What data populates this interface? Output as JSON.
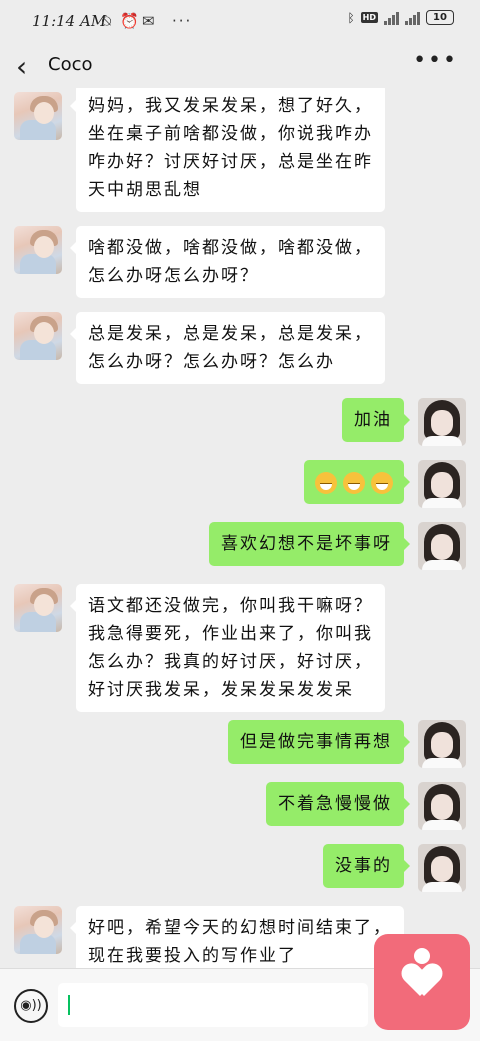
{
  "status_bar": {
    "time": "11:14 AM",
    "battery": "10",
    "hd": "HD"
  },
  "header": {
    "back_symbol": "‹",
    "title": "Coco",
    "more_symbol": "•••"
  },
  "messages": [
    {
      "from": "contact",
      "text": "妈妈，我又发呆发呆，想了好久，\n坐在桌子前啥都没做，你说我咋办\n咋办好？讨厌好讨厌，总是坐在昨\n天中胡思乱想"
    },
    {
      "from": "contact",
      "text": "啥都没做，啥都没做，啥都没做，\n怎么办呀怎么办呀？"
    },
    {
      "from": "contact",
      "text": "总是发呆，总是发呆，总是发呆，\n怎么办呀？怎么办呀？怎么办"
    },
    {
      "from": "me",
      "text": "加油"
    },
    {
      "from": "me",
      "emoji": [
        "grin",
        "grin",
        "grin"
      ]
    },
    {
      "from": "me",
      "text": "喜欢幻想不是坏事呀"
    },
    {
      "from": "contact",
      "text": "语文都还没做完，你叫我干嘛呀？\n我急得要死，作业出来了，你叫我\n怎么办？我真的好讨厌，好讨厌，\n好讨厌我发呆，发呆发呆发发呆"
    },
    {
      "from": "me",
      "text": "但是做完事情再想"
    },
    {
      "from": "me",
      "text": "不着急慢慢做"
    },
    {
      "from": "me",
      "text": "没事的"
    },
    {
      "from": "contact",
      "text": "好吧，希望今天的幻想时间结束了，\n现在我要投入的写作业了"
    }
  ],
  "input": {
    "value": "",
    "placeholder": ""
  },
  "icons": {
    "voice": "voice-icon",
    "floating": "heart-icon"
  },
  "colors": {
    "background": "#ededed",
    "incoming_bubble": "#ffffff",
    "outgoing_bubble": "#95ec69",
    "floating_button": "#f26b7a"
  }
}
